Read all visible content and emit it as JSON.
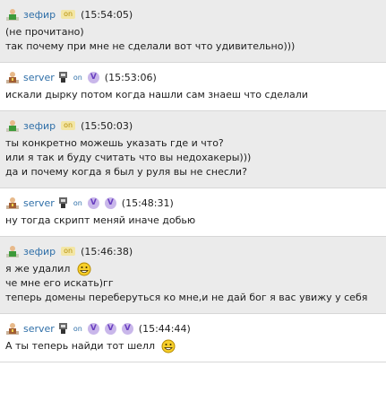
{
  "messages": [
    {
      "id": "m1",
      "nick": "зефир",
      "status": "on",
      "time": "(15:54:05)",
      "lines": [
        "(не прочитано)",
        "так почему при мне не сделали вот что удивительно)))"
      ]
    },
    {
      "id": "m2",
      "nick": "server",
      "status": "on",
      "time": "(15:53:06)",
      "lines": [
        "искали дырку потом когда нашли сам знаеш что сделали"
      ]
    },
    {
      "id": "m3",
      "nick": "зефир",
      "status": "on",
      "time": "(15:50:03)",
      "lines": [
        "ты конкретно можешь указать где и что?",
        "или я так и буду считать что вы недохакеры)))",
        "да и почему когда я был у руля вы не снесли?"
      ]
    },
    {
      "id": "m4",
      "nick": "server",
      "status": "on",
      "time": "(15:48:31)",
      "lines": [
        "ну тогда скрипт меняй иначе добью"
      ]
    },
    {
      "id": "m5",
      "nick": "зефир",
      "status": "on",
      "time": "(15:46:38)",
      "lines": [
        "я же удалил",
        "че мне его искать)гг",
        "теперь домены переберуться ко мне,и не дай бог я вас увижу у себя"
      ]
    },
    {
      "id": "m6",
      "nick": "server",
      "status": "on",
      "time": "(15:44:44)",
      "lines": [
        "А ты теперь найди тот шелл"
      ]
    }
  ],
  "badge_letter": "V",
  "colors": {
    "nick": "#2f6fa8",
    "status_on_bg": "#f3e6a5",
    "status_on_fg": "#b8910b",
    "alt_bg": "#ebebeb",
    "badge_bg": "#c9b7ea",
    "badge_fg": "#6a3fc0"
  },
  "icons": {
    "zefir_avatar": "green-person-icon",
    "server_avatar": "medal-person-icon",
    "server_badge": "mini-figure-icon",
    "smile": "grin-smiley-icon"
  }
}
